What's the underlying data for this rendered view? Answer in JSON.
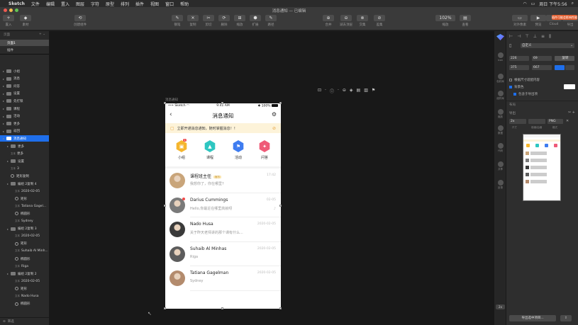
{
  "menubar": {
    "apple": "",
    "app": "Sketch",
    "items": [
      "文件",
      "编辑",
      "置入",
      "图层",
      "字符",
      "原型",
      "排列",
      "插件",
      "视图",
      "窗口",
      "帮助"
    ],
    "time": "周日 下午5:56"
  },
  "window": {
    "title": "消息通知 — 已编辑"
  },
  "toolbar": {
    "left": [
      {
        "label": "置入",
        "icon": "+"
      },
      {
        "label": "素材",
        "icon": "◆"
      },
      {
        "label": "创建组件",
        "icon": "⟲"
      }
    ],
    "mid": [
      {
        "label": "钢笔",
        "icon": "✎"
      },
      {
        "label": "复制",
        "icon": "✕"
      },
      {
        "label": "剪切",
        "icon": "✂"
      },
      {
        "label": "删除",
        "icon": "⟳"
      },
      {
        "label": "缩放",
        "icon": "⊞"
      },
      {
        "label": "扩展",
        "icon": "⬢"
      },
      {
        "label": "路径",
        "icon": "✎"
      }
    ],
    "bool": [
      {
        "label": "合并",
        "icon": "⊕"
      },
      {
        "label": "减去顶层",
        "icon": "⊖"
      },
      {
        "label": "交集",
        "icon": "⊗"
      },
      {
        "label": "差集",
        "icon": "⊘"
      }
    ],
    "zoom": "102%",
    "zoom_label": "缩放",
    "view_label": "查看",
    "right": [
      {
        "label": "对外像素",
        "icon": "▭"
      },
      {
        "label": "预览",
        "icon": "▶"
      },
      {
        "label": "Cloud",
        "icon": "☁"
      },
      {
        "label": "导出",
        "icon": "⇪"
      }
    ],
    "warning": "插件可能会影响性能"
  },
  "left": {
    "pages_header": "页面",
    "pages": [
      "页面1",
      "插件"
    ],
    "layers": [
      {
        "label": "小组",
        "depth": 0,
        "type": "folder"
      },
      {
        "label": "消息",
        "depth": 0,
        "type": "folder"
      },
      {
        "label": "问答",
        "depth": 0,
        "type": "folder"
      },
      {
        "label": "设置",
        "depth": 0,
        "type": "folder"
      },
      {
        "label": "先打铁",
        "depth": 0,
        "type": "folder"
      },
      {
        "label": "课程",
        "depth": 0,
        "type": "folder"
      },
      {
        "label": "活动",
        "depth": 0,
        "type": "folder"
      },
      {
        "label": "更多",
        "depth": 0,
        "type": "folder"
      },
      {
        "label": "返回",
        "depth": 0,
        "type": "folder"
      },
      {
        "label": "消息通知",
        "depth": 0,
        "type": "artboard",
        "selected": true
      },
      {
        "label": "更多",
        "depth": 1,
        "type": "folder"
      },
      {
        "label": "更多",
        "depth": 1,
        "type": "text",
        "tag": "文本"
      },
      {
        "label": "设置",
        "depth": 1,
        "type": "folder"
      },
      {
        "label": "3",
        "depth": 1,
        "type": "text",
        "tag": "文本"
      },
      {
        "label": "矩形复制",
        "depth": 1,
        "type": "shape"
      },
      {
        "label": "编组 2复制 4",
        "depth": 1,
        "type": "folder"
      },
      {
        "label": "2020-02-05",
        "depth": 2,
        "type": "text",
        "tag": "文本"
      },
      {
        "label": "矩形",
        "depth": 2,
        "type": "shape"
      },
      {
        "label": "Tatiana Gagel...",
        "depth": 2,
        "type": "text",
        "tag": "文本"
      },
      {
        "label": "椭圆形",
        "depth": 2,
        "type": "shape"
      },
      {
        "label": "Sydney",
        "depth": 2,
        "type": "text",
        "tag": "文本"
      },
      {
        "label": "编组 2复制 3",
        "depth": 1,
        "type": "folder"
      },
      {
        "label": "2020-02-05",
        "depth": 2,
        "type": "text",
        "tag": "文本"
      },
      {
        "label": "矩形",
        "depth": 2,
        "type": "shape"
      },
      {
        "label": "Suhaib Al Minh...",
        "depth": 2,
        "type": "text",
        "tag": "文本"
      },
      {
        "label": "椭圆形",
        "depth": 2,
        "type": "shape"
      },
      {
        "label": "Riga",
        "depth": 2,
        "type": "text",
        "tag": "文本"
      },
      {
        "label": "编组 2复制 2",
        "depth": 1,
        "type": "folder"
      },
      {
        "label": "2020-02-05",
        "depth": 2,
        "type": "text",
        "tag": "文本"
      },
      {
        "label": "矩形",
        "depth": 2,
        "type": "shape"
      },
      {
        "label": "Nado Husa",
        "depth": 2,
        "type": "text",
        "tag": "文本"
      },
      {
        "label": "椭圆形",
        "depth": 2,
        "type": "shape"
      }
    ],
    "filter": "筛选"
  },
  "artboard": {
    "name": "消息通知"
  },
  "phone": {
    "carrier": "Sketch",
    "time": "9:41 AM",
    "battery": "100%",
    "title": "消息通知",
    "banner": "立即开通消息通知，随时掌握消息！！",
    "categories": [
      {
        "label": "小组",
        "badge": "1",
        "color": "#f5b62e"
      },
      {
        "label": "课程",
        "color": "#2ec6c1"
      },
      {
        "label": "活动",
        "color": "#3e7cf0"
      },
      {
        "label": "问答",
        "color": "#ef5b78"
      }
    ],
    "messages": [
      {
        "name": "课程班主任",
        "tag": "官方",
        "sub": "我想你了，你在哪里?",
        "time": "17:42",
        "avatar": "#c9a57a"
      },
      {
        "name": "Darius Cummings",
        "sub": "Hello,你最近在哪里高就呀",
        "time": "02-05",
        "avatar": "#7a7a7a",
        "dot": true
      },
      {
        "name": "Nado Husa",
        "sub": "关于昨天老师讲的那个课有什么...",
        "time": "2020-02-05",
        "avatar": "#3a3a3a"
      },
      {
        "name": "Suhaib Al Minhas",
        "sub": "Riga",
        "time": "2020-02-05",
        "avatar": "#5c5c5c"
      },
      {
        "name": "Tatiana Gagelman",
        "sub": "Sydney",
        "time": "2020-02-05",
        "avatar": "#b38b6d"
      }
    ]
  },
  "inspector": {
    "style_label": "自定义",
    "x": "226",
    "y": "69",
    "w": "375",
    "h": "667",
    "rotate_label": "旋转",
    "adjust_label": "根据尺寸适配内容",
    "bg_label": "背景色",
    "export_bg_label": "包含于导出项",
    "layout_label": "布局",
    "export_header": "导出",
    "export_scale": "2x",
    "export_format": "PNG",
    "export_cols": [
      "尺寸",
      "前缀/后缀",
      "格式"
    ],
    "export_button": "导出选中项目..."
  },
  "rail": [
    "Icon",
    "色彩库",
    "组件库",
    "缩放",
    "数据",
    "代码",
    "共享",
    "反馈"
  ],
  "colors": {
    "accent": "#1f6feb",
    "warning": "#e25c2d",
    "banner": "#fdf3d9"
  }
}
